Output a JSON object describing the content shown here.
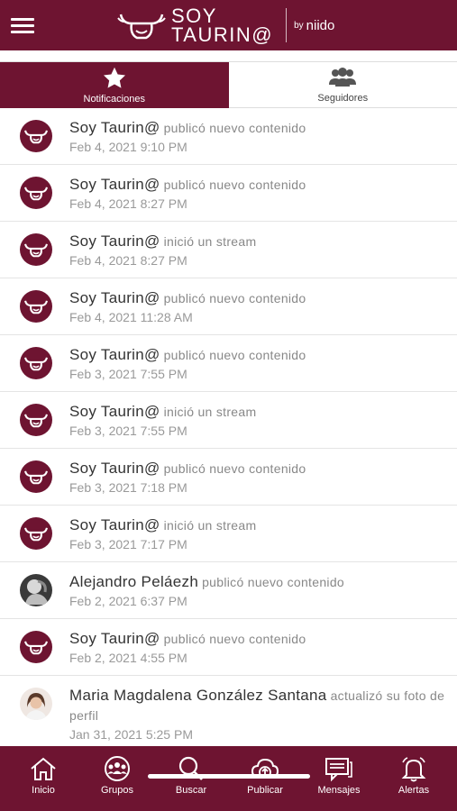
{
  "header": {
    "logo_line1": "SOY",
    "logo_line2": "TAURIN@",
    "by": "by",
    "brand": "niido"
  },
  "tabs": [
    {
      "label": "Notificaciones",
      "icon": "star-icon",
      "active": true
    },
    {
      "label": "Seguidores",
      "icon": "users-icon",
      "active": false
    }
  ],
  "notifications": [
    {
      "actor": "Soy Taurin@",
      "action": "publicó nuevo contenido",
      "time": "Feb 4, 2021 9:10 PM"
    },
    {
      "actor": "Soy Taurin@",
      "action": "publicó nuevo contenido",
      "time": "Feb 4, 2021 8:27 PM"
    },
    {
      "actor": "Soy Taurin@",
      "action": "inició un stream",
      "time": "Feb 4, 2021 8:27 PM"
    },
    {
      "actor": "Soy Taurin@",
      "action": "publicó nuevo contenido",
      "time": "Feb 4, 2021 11:28 AM"
    },
    {
      "actor": "Soy Taurin@",
      "action": "publicó nuevo contenido",
      "time": "Feb 3, 2021 7:55 PM"
    },
    {
      "actor": "Soy Taurin@",
      "action": "inició un stream",
      "time": "Feb 3, 2021 7:55 PM"
    },
    {
      "actor": "Soy Taurin@",
      "action": "publicó nuevo contenido",
      "time": "Feb 3, 2021 7:18 PM"
    },
    {
      "actor": "Soy Taurin@",
      "action": "inició un stream",
      "time": "Feb 3, 2021 7:17 PM"
    },
    {
      "actor": "Alejandro Peláezh",
      "action": "publicó nuevo contenido",
      "time": "Feb 2, 2021 6:37 PM"
    },
    {
      "actor": "Soy Taurin@",
      "action": "publicó nuevo contenido",
      "time": "Feb 2, 2021 4:55 PM"
    },
    {
      "actor": "Maria Magdalena González Santana",
      "action": "actualizó su foto de perfil",
      "time": "Jan 31, 2021 5:25 PM"
    }
  ],
  "bottom_nav": [
    {
      "label": "Inicio",
      "icon": "home-icon"
    },
    {
      "label": "Grupos",
      "icon": "groups-icon"
    },
    {
      "label": "Buscar",
      "icon": "search-icon"
    },
    {
      "label": "Publicar",
      "icon": "upload-cloud-icon"
    },
    {
      "label": "Mensajes",
      "icon": "messages-icon"
    },
    {
      "label": "Alertas",
      "icon": "bell-icon"
    }
  ],
  "colors": {
    "brand": "#6e1431",
    "text": "#333333",
    "muted": "#999999"
  }
}
